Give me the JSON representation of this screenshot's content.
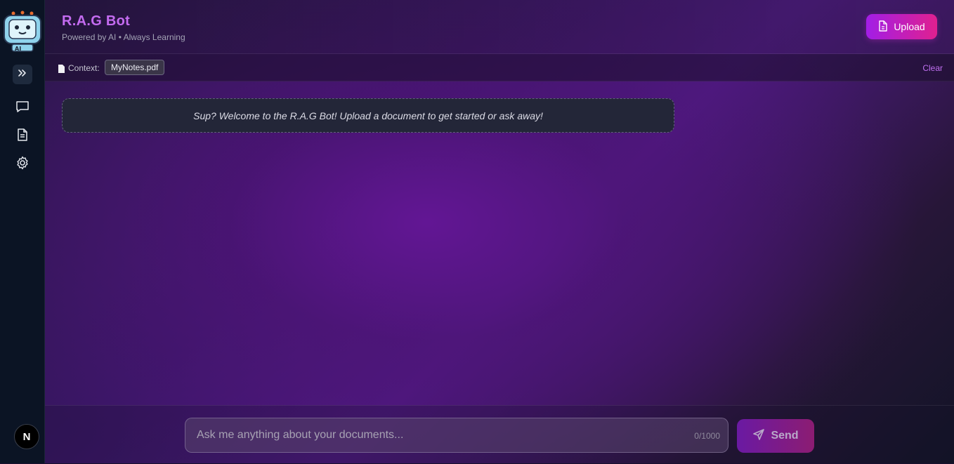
{
  "header": {
    "title": "R.A.G Bot",
    "subtitle": "Powered by AI • Always Learning",
    "upload_label": "Upload"
  },
  "logo": {
    "badge": "AI"
  },
  "context": {
    "label": "Context:",
    "file": "MyNotes.pdf",
    "clear_label": "Clear"
  },
  "chat": {
    "welcome": "Sup? Welcome to the R.A.G Bot! Upload a document to get started or ask away!"
  },
  "composer": {
    "placeholder": "Ask me anything about your documents...",
    "char_count": "0/1000",
    "send_label": "Send"
  },
  "sidebar": {
    "icons": [
      "chevrons-right-icon",
      "chat-icon",
      "document-icon",
      "gear-icon"
    ],
    "avatar": "N"
  },
  "colors": {
    "accent": "#c46bf0",
    "upload_gradient_start": "#a21ee6",
    "upload_gradient_end": "#e0208f",
    "sidebar_bg": "#0b1424"
  }
}
